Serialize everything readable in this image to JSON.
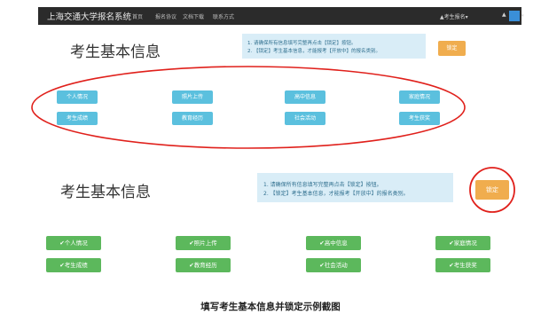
{
  "navbar": {
    "brand": "上海交通大学报名系统",
    "items": [
      "首页",
      "报名协议",
      "文档下载",
      "联系方式"
    ],
    "user_menu": "▲考生报名▾",
    "account_caret": "▾"
  },
  "panel_top": {
    "title": "考生基本信息",
    "notice": [
      "1. 请确保所有信息填写完整再点击【锁定】按钮。",
      "2. 【锁定】考生基本信息，才能报考【开放中】的报名类别。"
    ],
    "lock_label": "锁定",
    "buttons": [
      "个人情况",
      "照片上传",
      "高中信息",
      "家庭情况",
      "考生成绩",
      "教育经历",
      "社会活动",
      "考生获奖"
    ]
  },
  "panel_bottom": {
    "title": "考生基本信息",
    "notice": [
      "1. 请确保所有信息填写完整再点击【锁定】按钮。",
      "2. 【锁定】考生基本信息，才能报考【开放中】的报名类别。"
    ],
    "lock_label": "锁定",
    "buttons": [
      "✔个人情况",
      "✔照片上传",
      "✔高中信息",
      "✔家庭情况",
      "✔考生成绩",
      "✔教育经历",
      "✔社会活动",
      "✔考生获奖"
    ]
  },
  "caption": "填写考生基本信息并锁定示例截图",
  "colors": {
    "navbar": "#2b2b2b",
    "info_btn": "#5bc0de",
    "success_btn": "#5cb85c",
    "warning_btn": "#f0ad4e",
    "notice_bg": "#d9edf7",
    "annotation_red": "#e0201b"
  }
}
